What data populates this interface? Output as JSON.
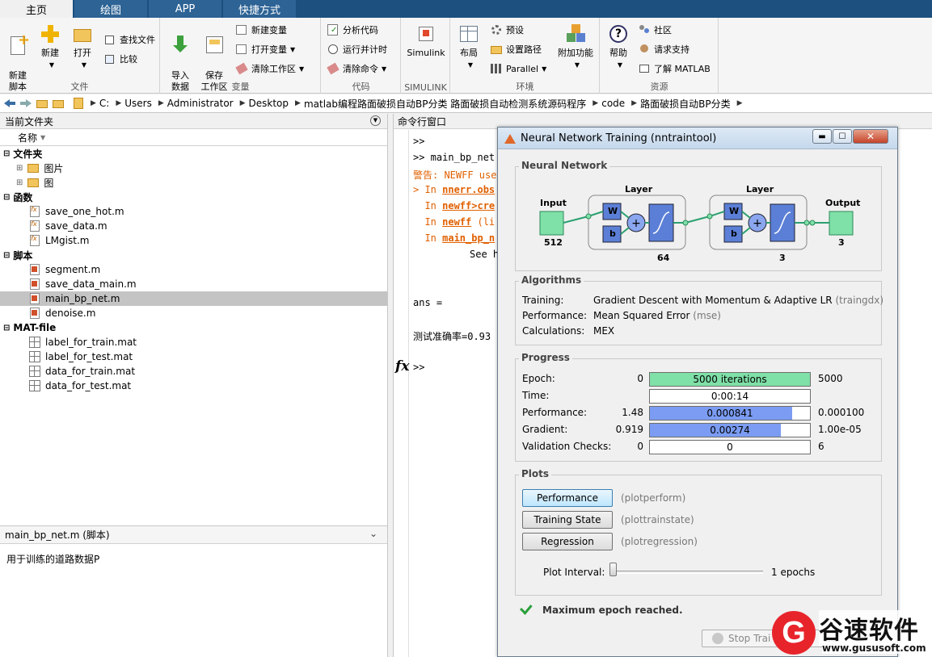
{
  "ribbon_tabs": [
    "主页",
    "绘图",
    "APP",
    "快捷方式"
  ],
  "file_group": {
    "new_script": "新建\n脚本",
    "new": "新建",
    "open": "打开",
    "find_files": "查找文件",
    "compare": "比较",
    "label": "文件"
  },
  "variable_group": {
    "import": "导入\n数据",
    "save_ws": "保存\n工作区",
    "new_var": "新建变量",
    "open_var": "打开变量",
    "clear_ws": "清除工作区",
    "label": "变量"
  },
  "code_group": {
    "analyze": "分析代码",
    "run_time": "运行并计时",
    "clear_cmd": "清除命令",
    "label": "代码"
  },
  "simulink_group": {
    "simulink": "Simulink",
    "label": "SIMULINK"
  },
  "env_group": {
    "layout": "布局",
    "prefs": "预设",
    "set_path": "设置路径",
    "parallel": "Parallel",
    "addons": "附加功能",
    "label": "环境"
  },
  "resources_group": {
    "help": "帮助",
    "community": "社区",
    "support": "请求支持",
    "learn": "了解 MATLAB",
    "label": "资源"
  },
  "breadcrumbs": [
    "C:",
    "Users",
    "Administrator",
    "Desktop",
    "matlab编程路面破损自动BP分类 路面破损自动检测系统源码程序",
    "code",
    "路面破损自动BP分类"
  ],
  "file_browser": {
    "title": "当前文件夹",
    "name_col": "名称",
    "sections": [
      {
        "name": "文件夹",
        "items": [
          "图片",
          "图"
        ]
      },
      {
        "name": "函数",
        "items": [
          "save_one_hot.m",
          "save_data.m",
          "LMgist.m"
        ]
      },
      {
        "name": "脚本",
        "items": [
          "segment.m",
          "save_data_main.m",
          "main_bp_net.m",
          "denoise.m"
        ]
      },
      {
        "name": "MAT-file",
        "items": [
          "label_for_train.mat",
          "label_for_test.mat",
          "data_for_train.mat",
          "data_for_test.mat"
        ]
      }
    ],
    "details_title": "main_bp_net.m  (脚本)",
    "details_text": "用于训练的道路数据P"
  },
  "command_window": {
    "title": "命令行窗口",
    "l1": ">>",
    "l2": ">> main_bp_net",
    "l3": "警告: NEWFF use",
    "l4a": "> In ",
    "l4b": "nnerr.obs",
    "l5b": "newff>cre",
    "l6b": "newff",
    "l6c": " (li",
    "l7b": "main_bp_n",
    "l8": "See h",
    "l9": "ans =",
    "l10": "测试准确率=0.93",
    "prompt": ">>",
    "fx": "fx"
  },
  "nntraintool": {
    "title": "Neural Network Training (nntraintool)",
    "nn_label": "Neural Network",
    "input_label": "Input",
    "input_size": "512",
    "layer1_label": "Layer",
    "layer1_size": "64",
    "layer2_label": "Layer",
    "layer2_size": "3",
    "output_label": "Output",
    "output_size": "3",
    "w": "W",
    "b": "b",
    "alg_label": "Algorithms",
    "training_k": "Training:",
    "training_v": "Gradient Descent with Momentum & Adaptive LR",
    "training_f": "(traingdx)",
    "perf_k": "Performance:",
    "perf_v": "Mean Squared Error",
    "perf_f": "(mse)",
    "calc_k": "Calculations:",
    "calc_v": "MEX",
    "progress_label": "Progress",
    "progress": [
      {
        "name": "Epoch:",
        "start": "0",
        "value": "5000 iterations",
        "end": "5000",
        "fill": 1.0,
        "color": "#7fe0a8"
      },
      {
        "name": "Time:",
        "start": "",
        "value": "0:00:14",
        "end": "",
        "fill": 0.0,
        "color": "#ffffff"
      },
      {
        "name": "Performance:",
        "start": "1.48",
        "value": "0.000841",
        "end": "0.000100",
        "fill": 0.89,
        "color": "#7b9cf2"
      },
      {
        "name": "Gradient:",
        "start": "0.919",
        "value": "0.00274",
        "end": "1.00e-05",
        "fill": 0.82,
        "color": "#7b9cf2"
      },
      {
        "name": "Validation Checks:",
        "start": "0",
        "value": "0",
        "end": "6",
        "fill": 0.0,
        "color": "#ffffff"
      }
    ],
    "plots_label": "Plots",
    "plot_perf": "Performance",
    "plot_perf_f": "(plotperform)",
    "plot_train": "Training State",
    "plot_train_f": "(plottrainstate)",
    "plot_reg": "Regression",
    "plot_reg_f": "(plotregression)",
    "interval_k": "Plot Interval:",
    "interval_v": "1 epochs",
    "status": "Maximum epoch reached.",
    "stop_training": "Stop Trai",
    "cancel": "ca"
  },
  "watermark": {
    "brand": "谷速软件",
    "url": "www.gususoft.com",
    "logo": "G"
  }
}
